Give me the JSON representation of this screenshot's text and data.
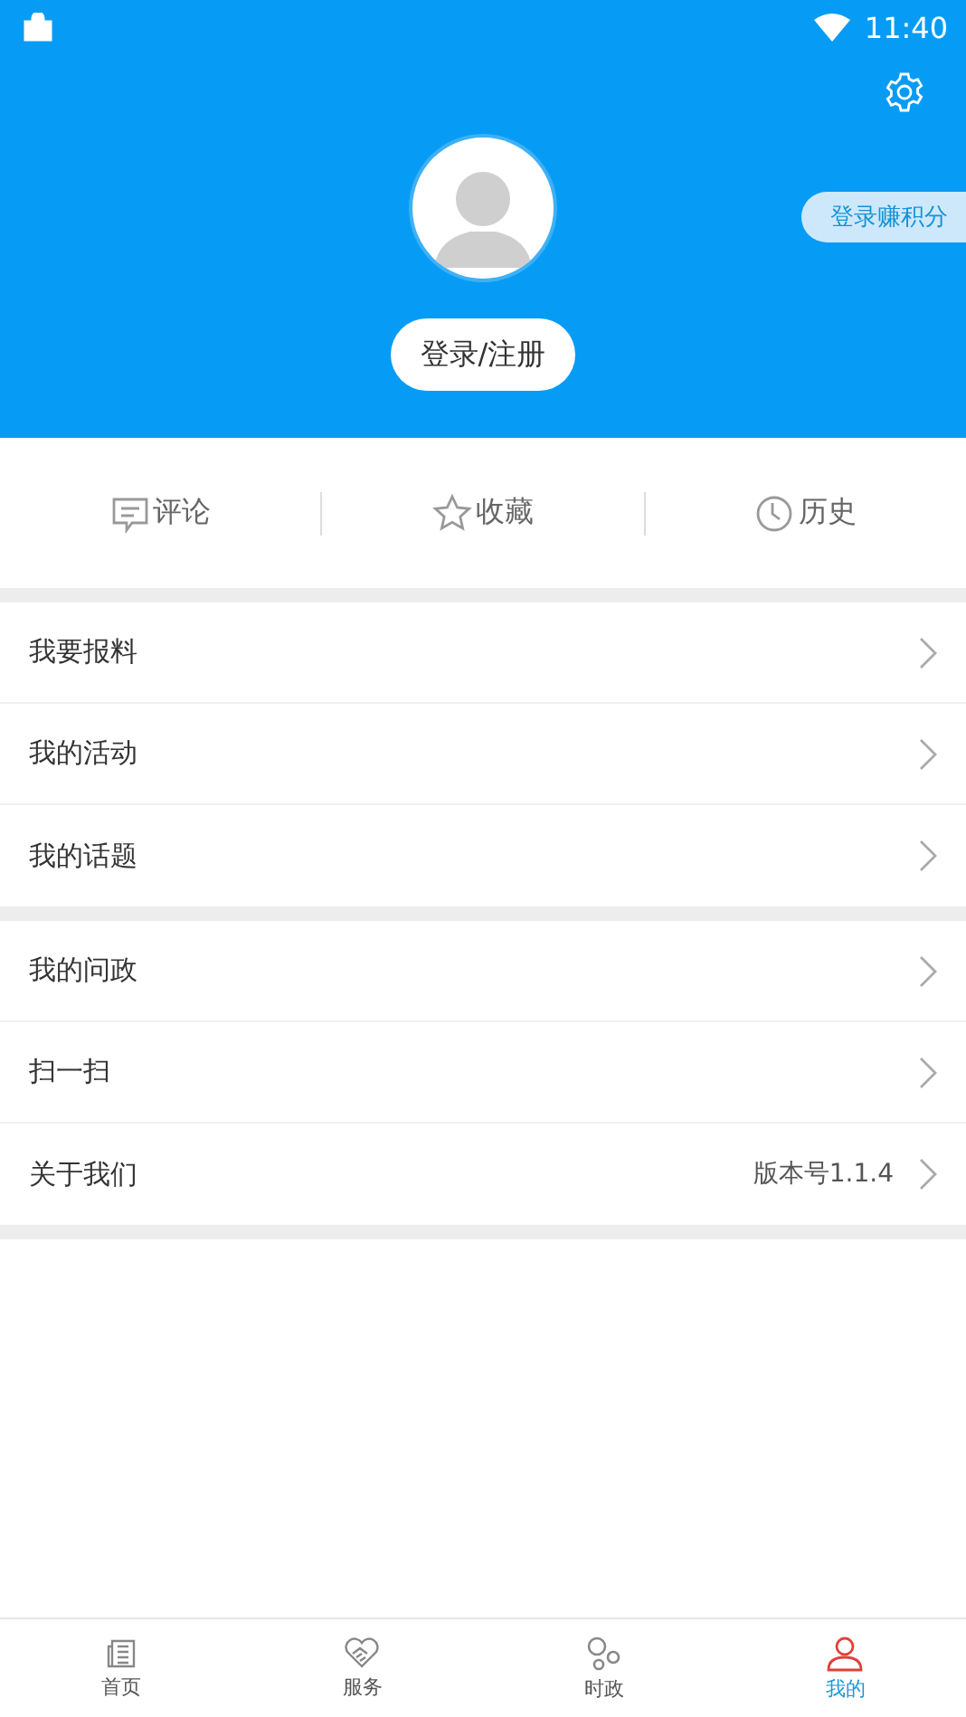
{
  "status_bar": {
    "time": "11:40"
  },
  "header": {
    "login_button": "登录/注册",
    "points_badge": "登录赚积分"
  },
  "shortcuts": [
    {
      "kind": "comment",
      "label": "评论"
    },
    {
      "kind": "star",
      "label": "收藏"
    },
    {
      "kind": "clock",
      "label": "历史"
    }
  ],
  "menu_groups": [
    [
      {
        "label": "我要报料"
      },
      {
        "label": "我的活动"
      },
      {
        "label": "我的话题"
      }
    ],
    [
      {
        "label": "我的问政"
      },
      {
        "label": "扫一扫"
      },
      {
        "label": "关于我们",
        "value": "版本号1.1.4"
      }
    ]
  ],
  "tab_bar": [
    {
      "kind": "news",
      "label": "首页",
      "selected": false
    },
    {
      "kind": "heart",
      "label": "服务",
      "selected": false
    },
    {
      "kind": "bubbles",
      "label": "时政",
      "selected": false
    },
    {
      "kind": "person",
      "label": "我的",
      "selected": true
    }
  ]
}
